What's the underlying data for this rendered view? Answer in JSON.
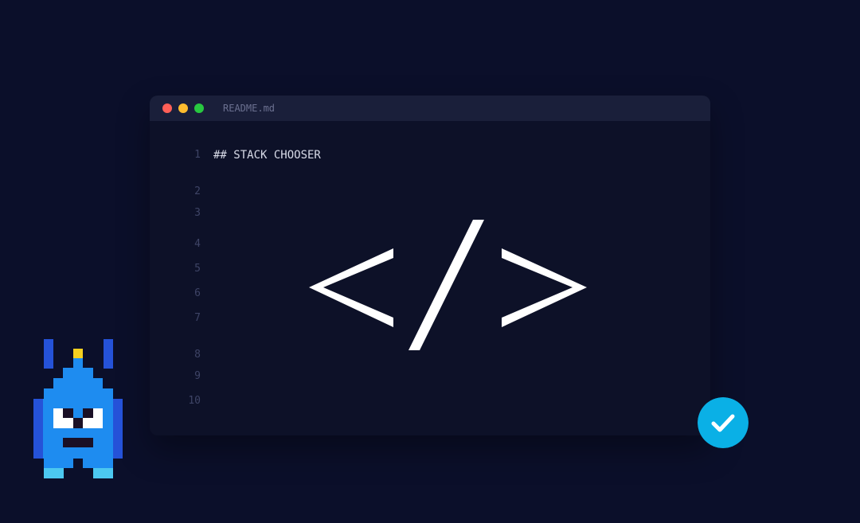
{
  "editor": {
    "filename": "README.md",
    "heading_line": "## STACK CHOOSER",
    "line_numbers": [
      "1",
      "2",
      "3",
      "4",
      "5",
      "6",
      "7",
      "8",
      "9",
      "10"
    ]
  },
  "colors": {
    "background": "#0b0f2a",
    "window_body": "#0d1128",
    "titlebar": "#1a1f3a",
    "traffic_red": "#ff5f57",
    "traffic_yellow": "#febc2e",
    "traffic_green": "#28c840",
    "glyph": "#ffffff",
    "check_badge": "#0ab0e6",
    "robot_body": "#1e8cf0",
    "robot_dark": "#2552d8",
    "robot_light": "#4cc8f0",
    "robot_antenna": "#f5d020"
  },
  "icons": {
    "code_glyph": "code-brackets-icon",
    "check_badge": "check-icon",
    "mascot": "pixel-robot-mascot"
  }
}
